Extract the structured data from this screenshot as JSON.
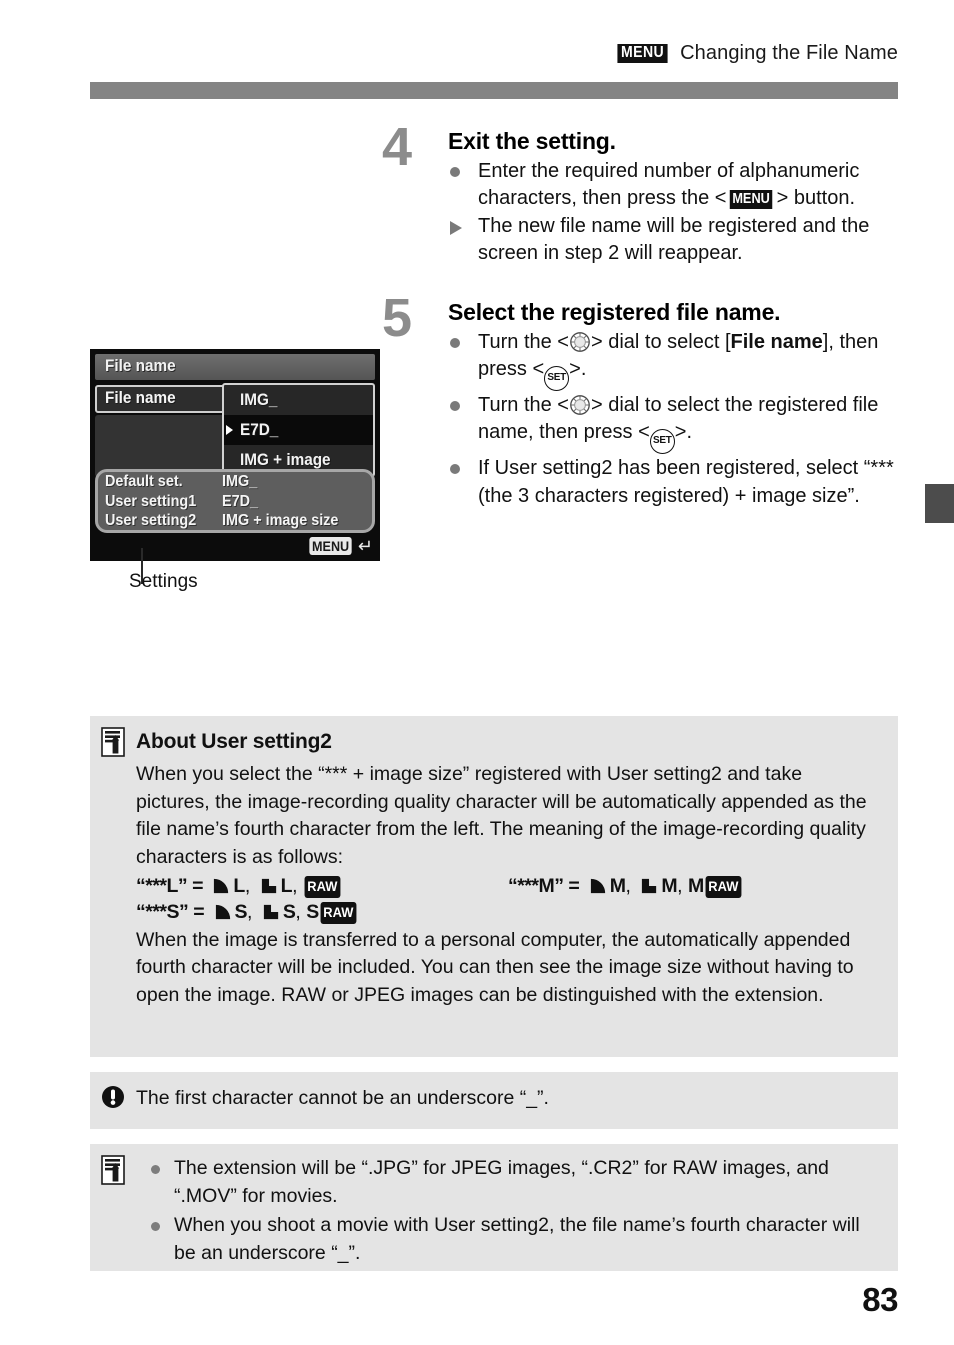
{
  "header": {
    "menu_badge": "MENU",
    "title": "Changing the File Name"
  },
  "steps": [
    {
      "number": "4",
      "title": "Exit the setting.",
      "bullets": [
        {
          "marker": "dot",
          "pre": "Enter the required number of alphanumeric characters, then press the <",
          "glyph": "MENU",
          "post": "> button."
        },
        {
          "marker": "triangle",
          "pre": "The new file name will be registered and the screen in step 2 will reappear.",
          "glyph": "",
          "post": ""
        }
      ]
    },
    {
      "number": "5",
      "title": "Select the registered file name.",
      "bullets": [
        {
          "marker": "dot",
          "seg1": "Turn the <",
          "g1": "quick-control-dial",
          "seg2": "> dial to select [",
          "bold": "File name",
          "seg3": "], then press <",
          "g2": "SET",
          "seg4": ">."
        },
        {
          "marker": "dot",
          "seg1": "Turn the <",
          "g1": "quick-control-dial",
          "seg2": "> dial to select the registered file name, then press <",
          "bold": "",
          "seg3": "",
          "g2": "SET",
          "seg4": ">."
        },
        {
          "marker": "dot",
          "text": "If User setting2 has been registered, select “*** (the 3 characters registered) + image size”."
        }
      ]
    }
  ],
  "figure": {
    "caption": "Settings",
    "lcd": {
      "titlebar": "File name",
      "main_row_label": "File name",
      "dropdown": [
        {
          "label": "IMG_",
          "selected": false
        },
        {
          "label": "E7D_",
          "selected": true
        },
        {
          "label": "IMG + image size",
          "selected": false
        }
      ],
      "settings_rows": [
        {
          "key": "Default set.",
          "value": "IMG_"
        },
        {
          "key": "User setting1",
          "value": "E7D_"
        },
        {
          "key": "User setting2",
          "value": "IMG + image size"
        }
      ],
      "menu_badge": "MENU",
      "return_glyph": "↵"
    }
  },
  "note_about": {
    "icon": "note-pencil-icon",
    "title": "About User setting2",
    "para1": "When you select the “*** + image size” registered with User setting2 and take pictures, the image-recording quality character will be automatically appended as the file name’s fourth character from the left. The meaning of the image-recording quality characters is as follows:",
    "quality": [
      {
        "left": {
          "code": "“***L” =",
          "items": [
            "fine L",
            "normal L",
            "RAW"
          ],
          "plain": "L"
        },
        "right": {
          "code": "“***M” =",
          "items": [
            "fine M",
            "normal M",
            "M RAW"
          ],
          "plain": "M"
        }
      },
      {
        "left": {
          "code": "“***S” =",
          "items": [
            "fine S",
            "normal S",
            "S RAW"
          ],
          "plain": "S"
        },
        "right": null
      }
    ],
    "raw_label": "RAW",
    "para2": "When the image is transferred to a personal computer, the automatically appended fourth character will be included. You can then see the image size without having to open the image. RAW or JPEG images can be distinguished with the extension."
  },
  "note_caution": {
    "icon": "caution-icon",
    "text": "The first character cannot be an underscore “_”."
  },
  "note_tips": {
    "icon": "note-pencil-icon",
    "items": [
      "The extension will be “.JPG” for JPEG images, “.CR2” for RAW images, and “.MOV” for movies.",
      "When you shoot a movie with User setting2, the file name’s fourth character will be an underscore “_”."
    ]
  },
  "page_number": "83",
  "colors": {
    "rule_gray": "#848484",
    "tab_gray": "#4c4c4c",
    "note_bg": "#e4e4e4",
    "step_number_gray": "#8c8c8c",
    "bullet_gray": "#7a7a7a"
  }
}
